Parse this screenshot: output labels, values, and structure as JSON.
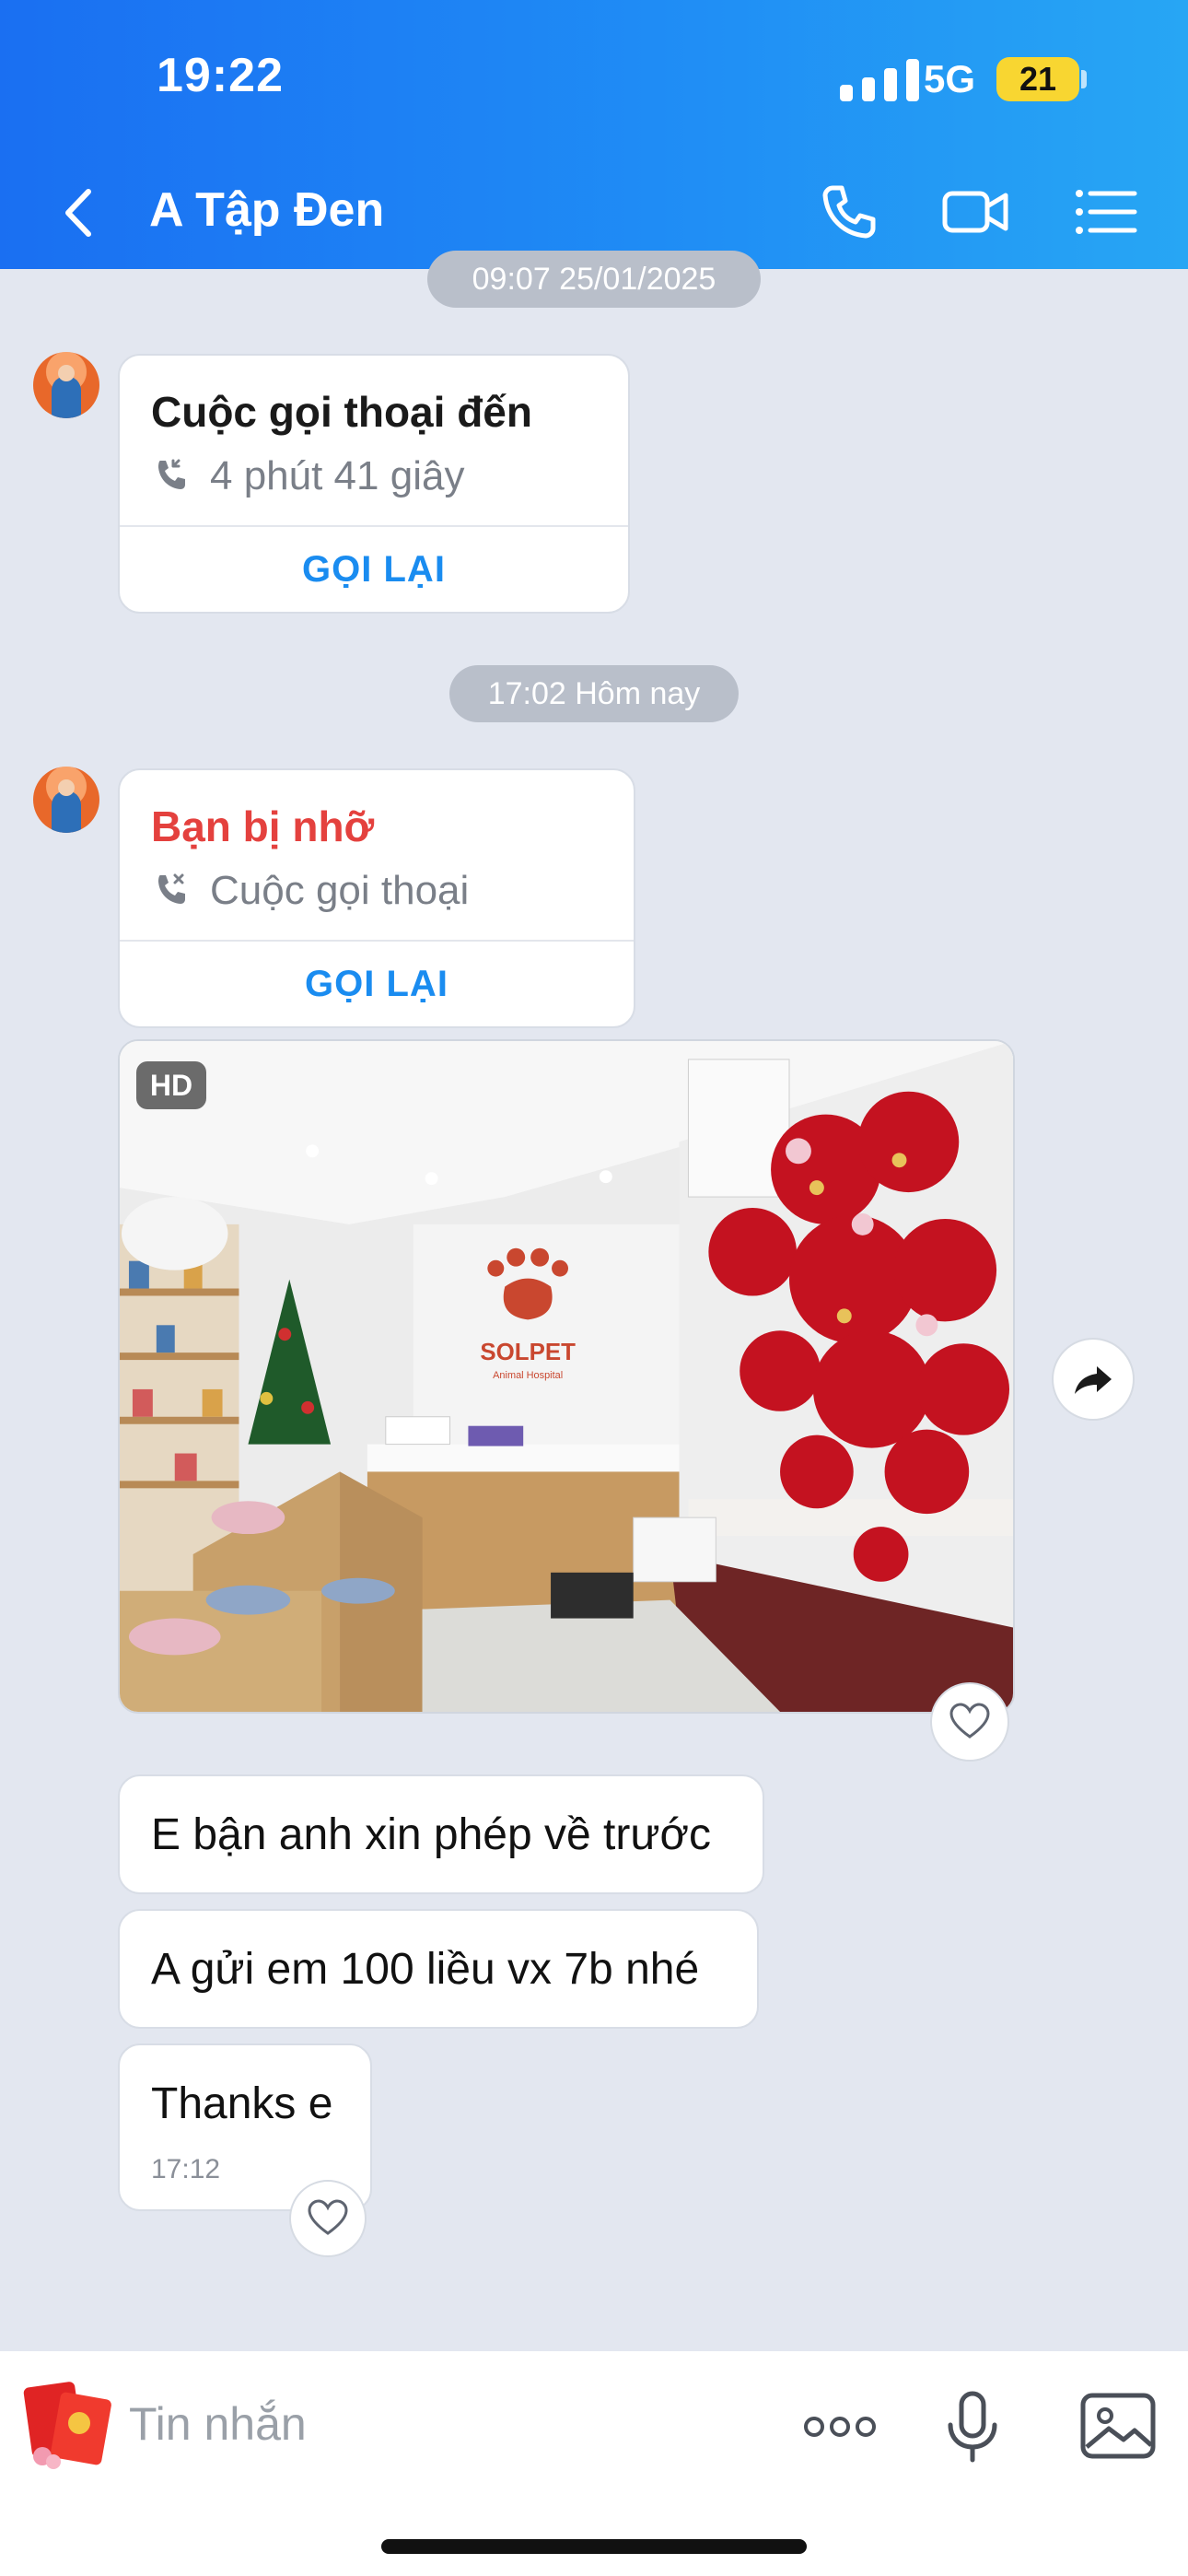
{
  "status_bar": {
    "time": "19:22",
    "network": "5G",
    "battery": "21"
  },
  "header": {
    "title": "A Tập Đen",
    "back_icon": "chevron-left-icon",
    "call_icon": "phone-icon",
    "video_icon": "video-camera-icon",
    "menu_icon": "list-menu-icon"
  },
  "messages": {
    "timestamp_1": "09:07 25/01/2025",
    "incoming_call": {
      "title": "Cuộc gọi thoại đến",
      "detail": "4 phút 41 giây",
      "action": "GỌI LẠI"
    },
    "timestamp_2": "17:02 Hôm nay",
    "missed_call": {
      "title": "Bạn bị nhỡ",
      "detail": "Cuộc gọi thoại",
      "action": "GỌI LẠI"
    },
    "photo": {
      "badge": "HD",
      "sign_text": "SOLPET",
      "sign_subtext": "Animal Hospital"
    },
    "text_1": "E bận anh xin phép về trước",
    "text_2": "A gửi em 100 liều vx 7b nhé",
    "text_3": "Thanks e",
    "text_3_time": "17:12"
  },
  "composer": {
    "placeholder": "Tin nhắn",
    "more_icon": "more-dots-icon",
    "mic_icon": "microphone-icon",
    "image_icon": "image-icon",
    "sticker_icon": "red-envelope-sticker-icon"
  },
  "colors": {
    "header_start": "#1a6ff2",
    "header_end": "#27a6f4",
    "accent": "#1a8cf0",
    "missed": "#e4413e",
    "background": "#e3e7f0"
  }
}
